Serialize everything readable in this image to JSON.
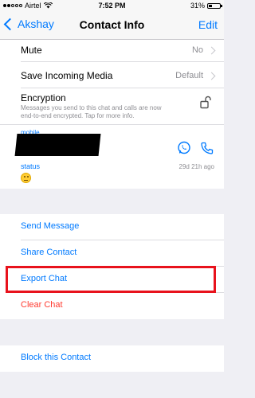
{
  "status_bar": {
    "carrier": "Airtel",
    "time": "7:52 PM",
    "battery_text": "31%",
    "battery_level": 0.31,
    "signal_icon": "signal-dots-icon",
    "wifi_icon": "wifi-icon"
  },
  "nav": {
    "back_label": "Akshay",
    "title": "Contact Info",
    "edit_label": "Edit"
  },
  "settings": {
    "mute_label": "Mute",
    "mute_value": "No",
    "save_media_label": "Save Incoming Media",
    "save_media_value": "Default",
    "encryption_label": "Encryption",
    "encryption_desc": "Messages you send to this chat and calls are now end-to-end encrypted. Tap for more info."
  },
  "contact": {
    "mobile_label": "mobile",
    "status_label": "status",
    "status_date": "29d 21h ago",
    "status_emoji": "thinking-face"
  },
  "actions": {
    "send_message": "Send Message",
    "share_contact": "Share Contact",
    "export_chat": "Export Chat",
    "clear_chat": "Clear Chat",
    "block_contact": "Block this Contact"
  },
  "colors": {
    "accent": "#007aff",
    "destructive": "#ff3b30",
    "highlight": "#e8121c",
    "whatsapp_icon": "#007aff"
  }
}
